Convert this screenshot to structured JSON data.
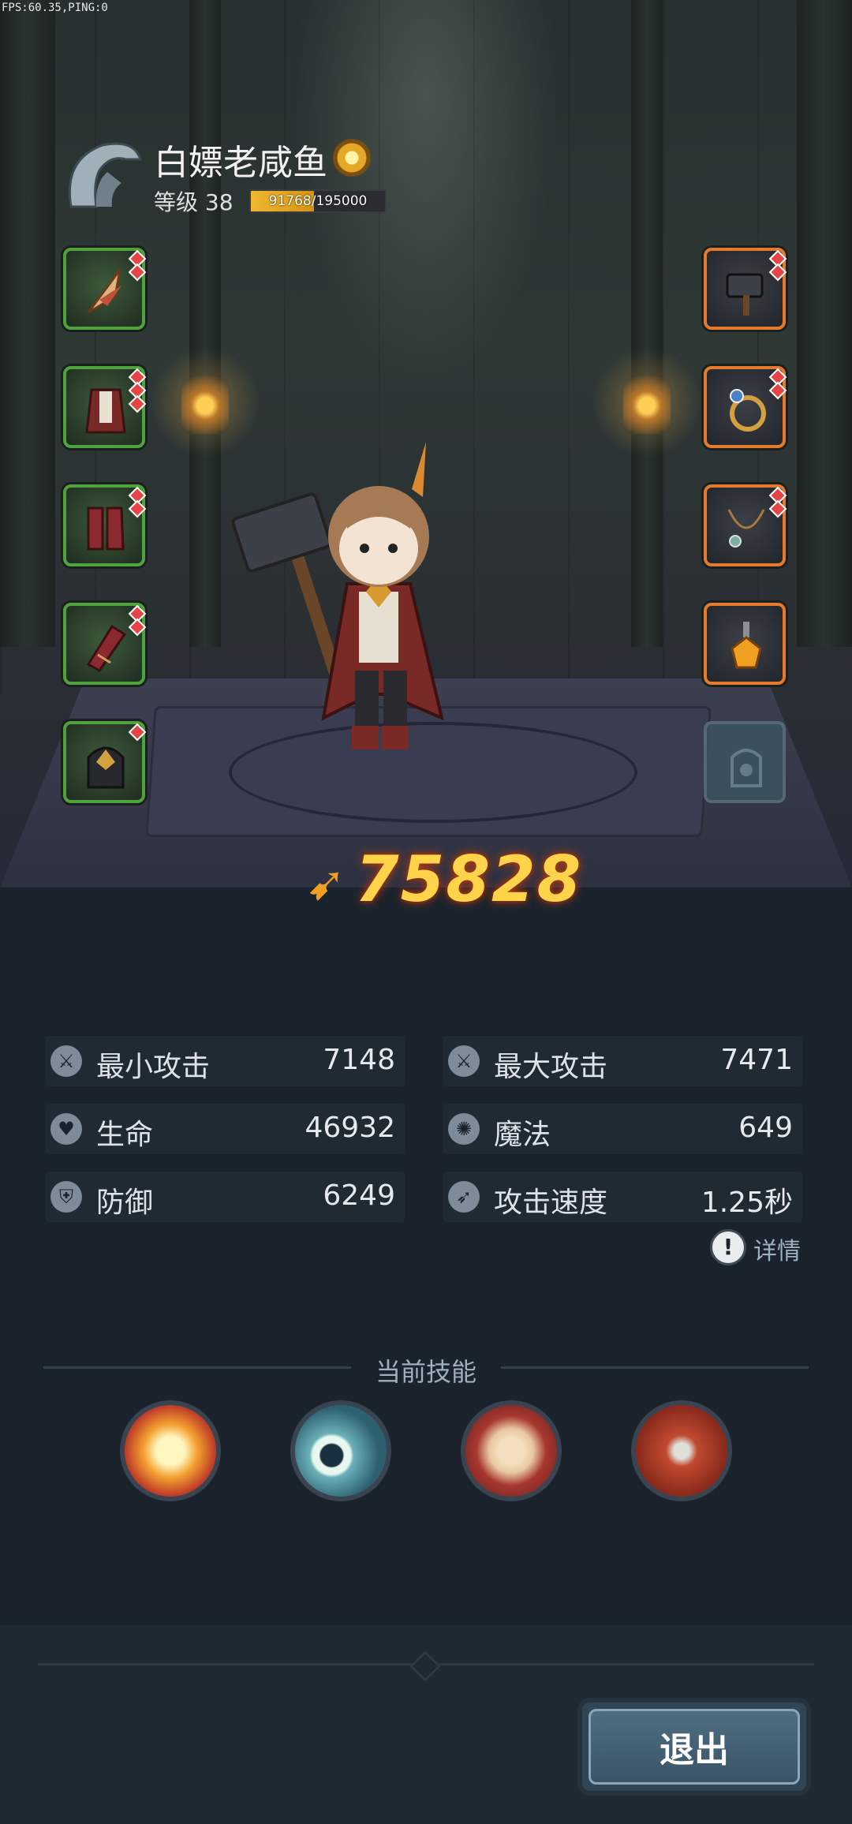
{
  "debug": {
    "fps_text": "FPS:60.35,PING:0"
  },
  "player": {
    "name": "白嫖老咸鱼",
    "level_label": "等级 38",
    "xp_text": "91768/195000",
    "xp_progress": 0.47
  },
  "equipment": {
    "left": [
      "feather-weapon-icon",
      "robe-armor-icon",
      "boots-icon",
      "bracer-icon",
      "helmet-icon"
    ],
    "right": [
      "hammer-icon",
      "ring-icon",
      "necklace-icon",
      "amulet-icon",
      "empty-slot-icon"
    ]
  },
  "power": {
    "value": "75828"
  },
  "stats": [
    {
      "label": "最小攻击",
      "value": "7148",
      "icon": "sword-icon"
    },
    {
      "label": "最大攻击",
      "value": "7471",
      "icon": "sword-icon"
    },
    {
      "label": "生命",
      "value": "46932",
      "icon": "heart-icon"
    },
    {
      "label": "魔法",
      "value": "649",
      "icon": "magic-icon"
    },
    {
      "label": "防御",
      "value": "6249",
      "icon": "shield-icon"
    },
    {
      "label": "攻击速度",
      "value": "1.25秒",
      "icon": "speed-icon"
    }
  ],
  "details": {
    "label": "详情"
  },
  "skills": {
    "title": "当前技能",
    "items": [
      "explosion-skill-icon",
      "frost-skill-icon",
      "blade-skill-icon",
      "crossed-axes-skill-icon"
    ]
  },
  "exit": {
    "label": "退出"
  },
  "colors": {
    "power": "#ffd34a",
    "slot_green": "#4ea33c",
    "slot_orange": "#e47a2d"
  }
}
